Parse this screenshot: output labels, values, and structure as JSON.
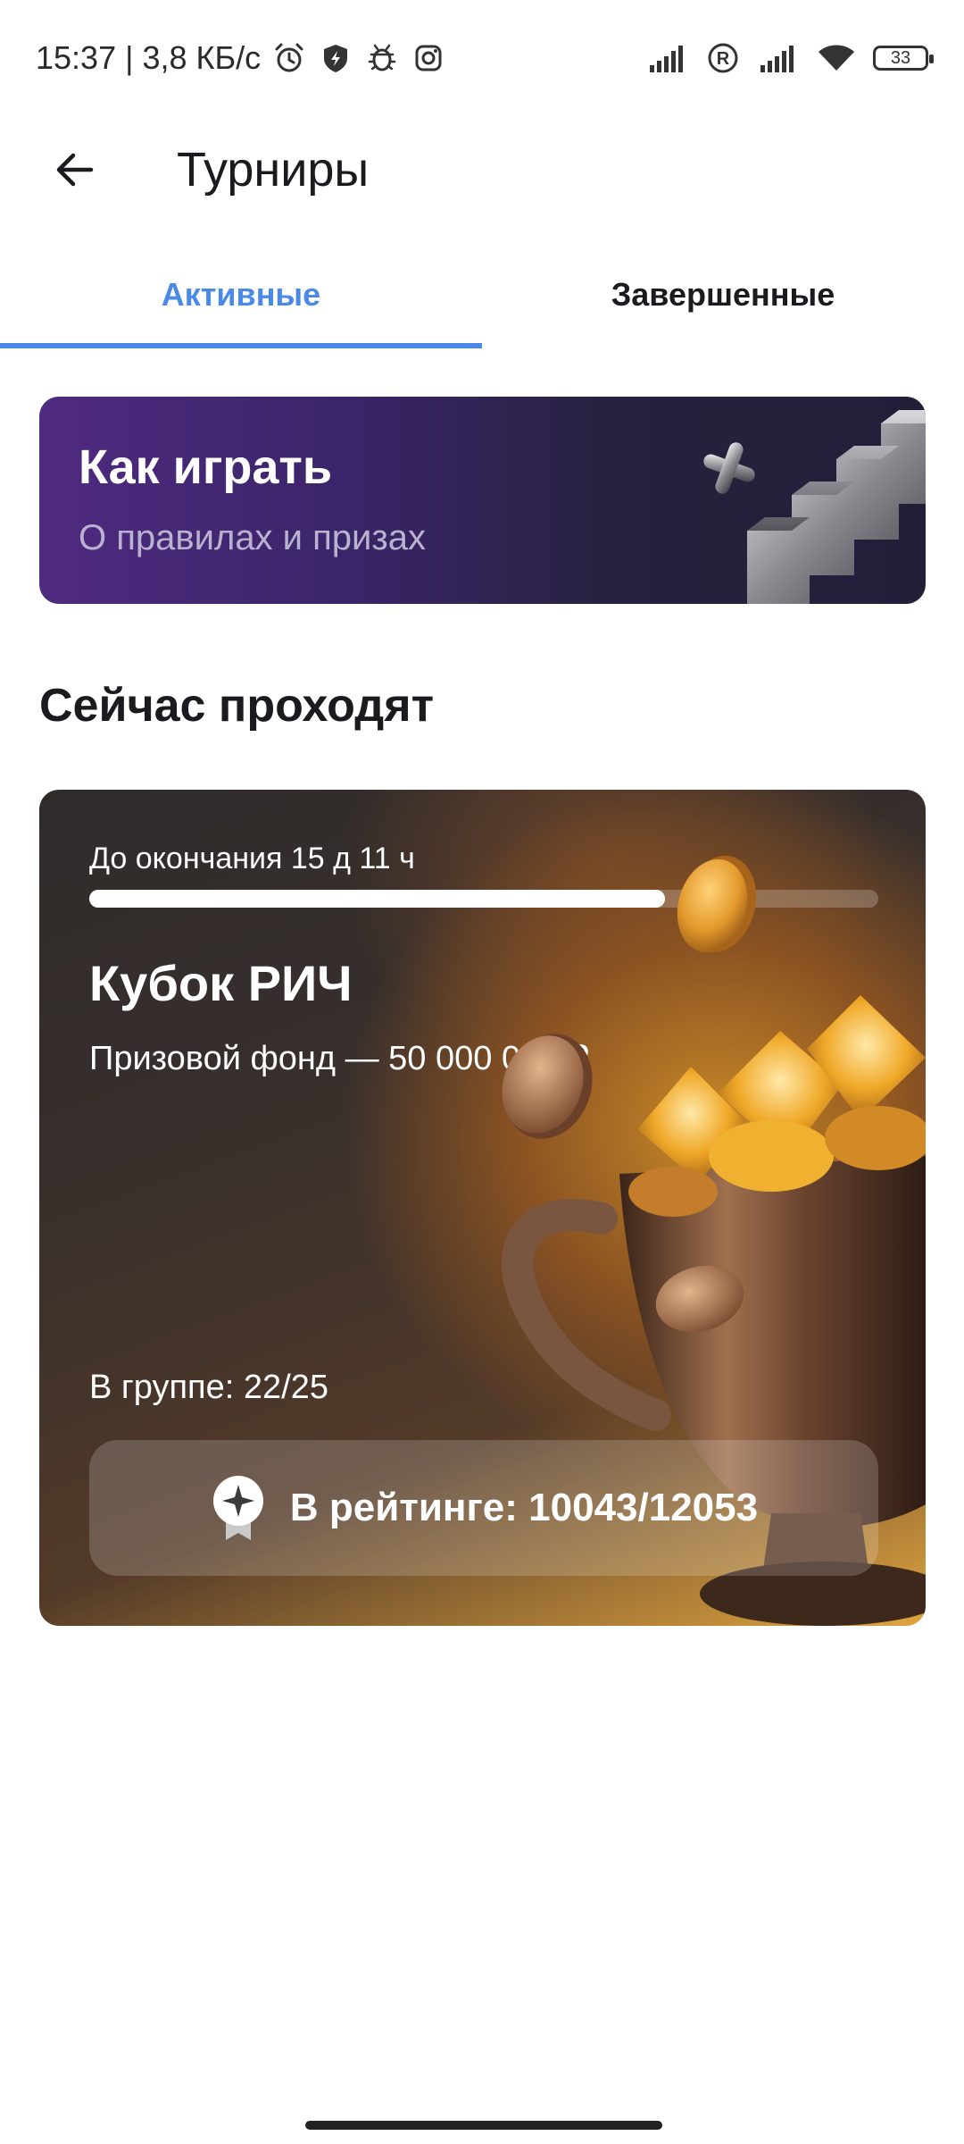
{
  "status_bar": {
    "time_speed": "15:37 | 3,8 КБ/с",
    "battery": "33",
    "icons": [
      "alarm-icon",
      "shield-icon",
      "bug-icon",
      "instagram-icon",
      "signal-icon",
      "roaming-icon",
      "signal-icon",
      "wifi-icon",
      "battery-icon"
    ]
  },
  "header": {
    "back_icon": "arrow-left-icon",
    "title": "Турниры"
  },
  "tabs": [
    {
      "label": "Активные",
      "active": true
    },
    {
      "label": "Завершенные",
      "active": false
    }
  ],
  "accent_color": "#4a8ae6",
  "howto": {
    "title": "Как играть",
    "subtitle": "О правилах и призах"
  },
  "section": {
    "title": "Сейчас проходят"
  },
  "tournament": {
    "deadline": "До окончания 15 д 11 ч",
    "progress": 0.73,
    "name": "Кубок РИЧ",
    "prize": "Призовой фонд — 50 000 000 ₽",
    "group": "В группе: 22/25",
    "rating": "В рейтинге: 10043/12053",
    "rating_icon": "award-badge-icon"
  }
}
